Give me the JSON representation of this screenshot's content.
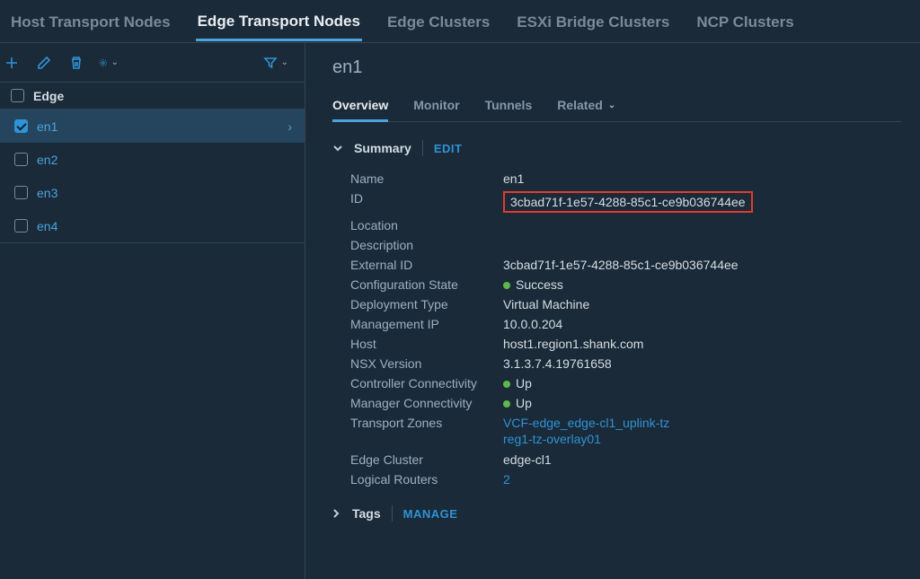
{
  "topTabs": {
    "host": "Host Transport Nodes",
    "edge": "Edge Transport Nodes",
    "edgeClusters": "Edge Clusters",
    "esxiBridge": "ESXi Bridge Clusters",
    "ncp": "NCP Clusters"
  },
  "listHeader": "Edge",
  "nodes": {
    "en1": "en1",
    "en2": "en2",
    "en3": "en3",
    "en4": "en4"
  },
  "detail": {
    "title": "en1",
    "subTabs": {
      "overview": "Overview",
      "monitor": "Monitor",
      "tunnels": "Tunnels",
      "related": "Related"
    },
    "summary": {
      "header": "Summary",
      "editLabel": "EDIT",
      "labels": {
        "name": "Name",
        "id": "ID",
        "location": "Location",
        "description": "Description",
        "externalId": "External ID",
        "configState": "Configuration State",
        "deployType": "Deployment Type",
        "mgmtIp": "Management IP",
        "host": "Host",
        "nsxVersion": "NSX Version",
        "ctrlConn": "Controller Connectivity",
        "mgrConn": "Manager Connectivity",
        "tz": "Transport Zones",
        "edgeCluster": "Edge Cluster",
        "logicalRouters": "Logical Routers"
      },
      "values": {
        "name": "en1",
        "id": "3cbad71f-1e57-4288-85c1-ce9b036744ee",
        "location": "",
        "description": "",
        "externalId": "3cbad71f-1e57-4288-85c1-ce9b036744ee",
        "configState": "Success",
        "deployType": "Virtual Machine",
        "mgmtIp": "10.0.0.204",
        "host": "host1.region1.shank.com",
        "nsxVersion": "3.1.3.7.4.19761658",
        "ctrlConn": "Up",
        "mgrConn": "Up",
        "tz1": "VCF-edge_edge-cl1_uplink-tz",
        "tz2": "reg1-tz-overlay01",
        "edgeCluster": "edge-cl1",
        "logicalRouters": "2"
      }
    },
    "tags": {
      "header": "Tags",
      "manageLabel": "MANAGE"
    }
  }
}
